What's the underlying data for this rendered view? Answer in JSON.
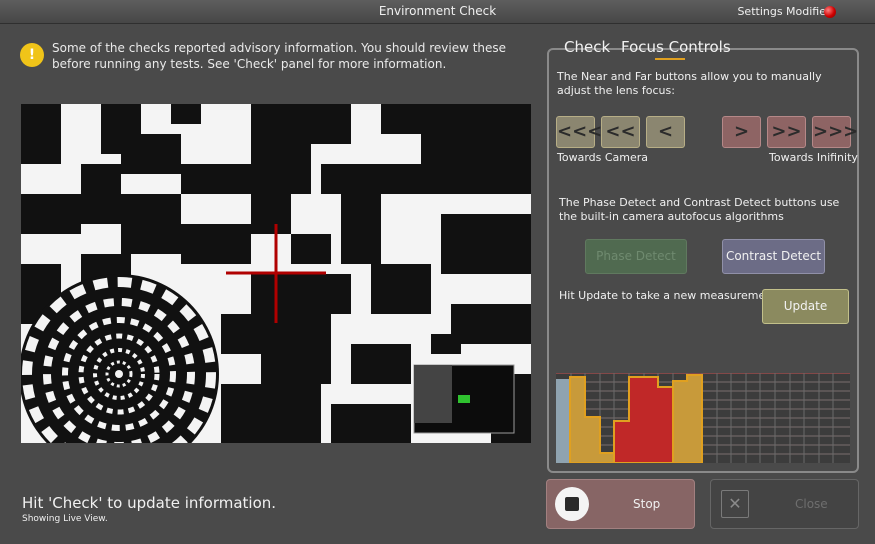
{
  "window": {
    "title": "Environment Check",
    "settings_status": "Settings Modified"
  },
  "advisory": {
    "icon": "exclamation-icon",
    "message": "Some of the checks reported advisory information.  You should review these before running any tests.  See 'Check' panel for more information."
  },
  "status": {
    "hint": "Hit 'Check' to update information.",
    "live_view": "Showing Live View."
  },
  "tabs": [
    {
      "label": "Check"
    },
    {
      "label": "Focus Controls"
    }
  ],
  "focus": {
    "manual_desc": "The Near and Far buttons allow you to manually adjust the lens focus:",
    "near_buttons": [
      "<<<",
      "<<",
      "<"
    ],
    "far_buttons": [
      ">",
      ">>",
      ">>>"
    ],
    "near_label": "Towards Camera",
    "far_label": "Towards Inifinity",
    "auto_desc": "The Phase Detect and Contrast Detect buttons use the built-in camera autofocus algorithms",
    "phase_label": "Phase Detect",
    "contrast_label": "Contrast Detect",
    "update_desc": "Hit Update to take a new measurement.",
    "update_label": "Update"
  },
  "actions": {
    "stop_label": "Stop",
    "close_label": "Close"
  },
  "colors": {
    "indicator": "#d00000",
    "near_button": "#8b8670",
    "far_button": "#8e6464",
    "contrast_button": "#6c6c86",
    "update_button": "#8b8a5f",
    "stop_button": "#876565",
    "tab_accent": "#e0a020"
  }
}
